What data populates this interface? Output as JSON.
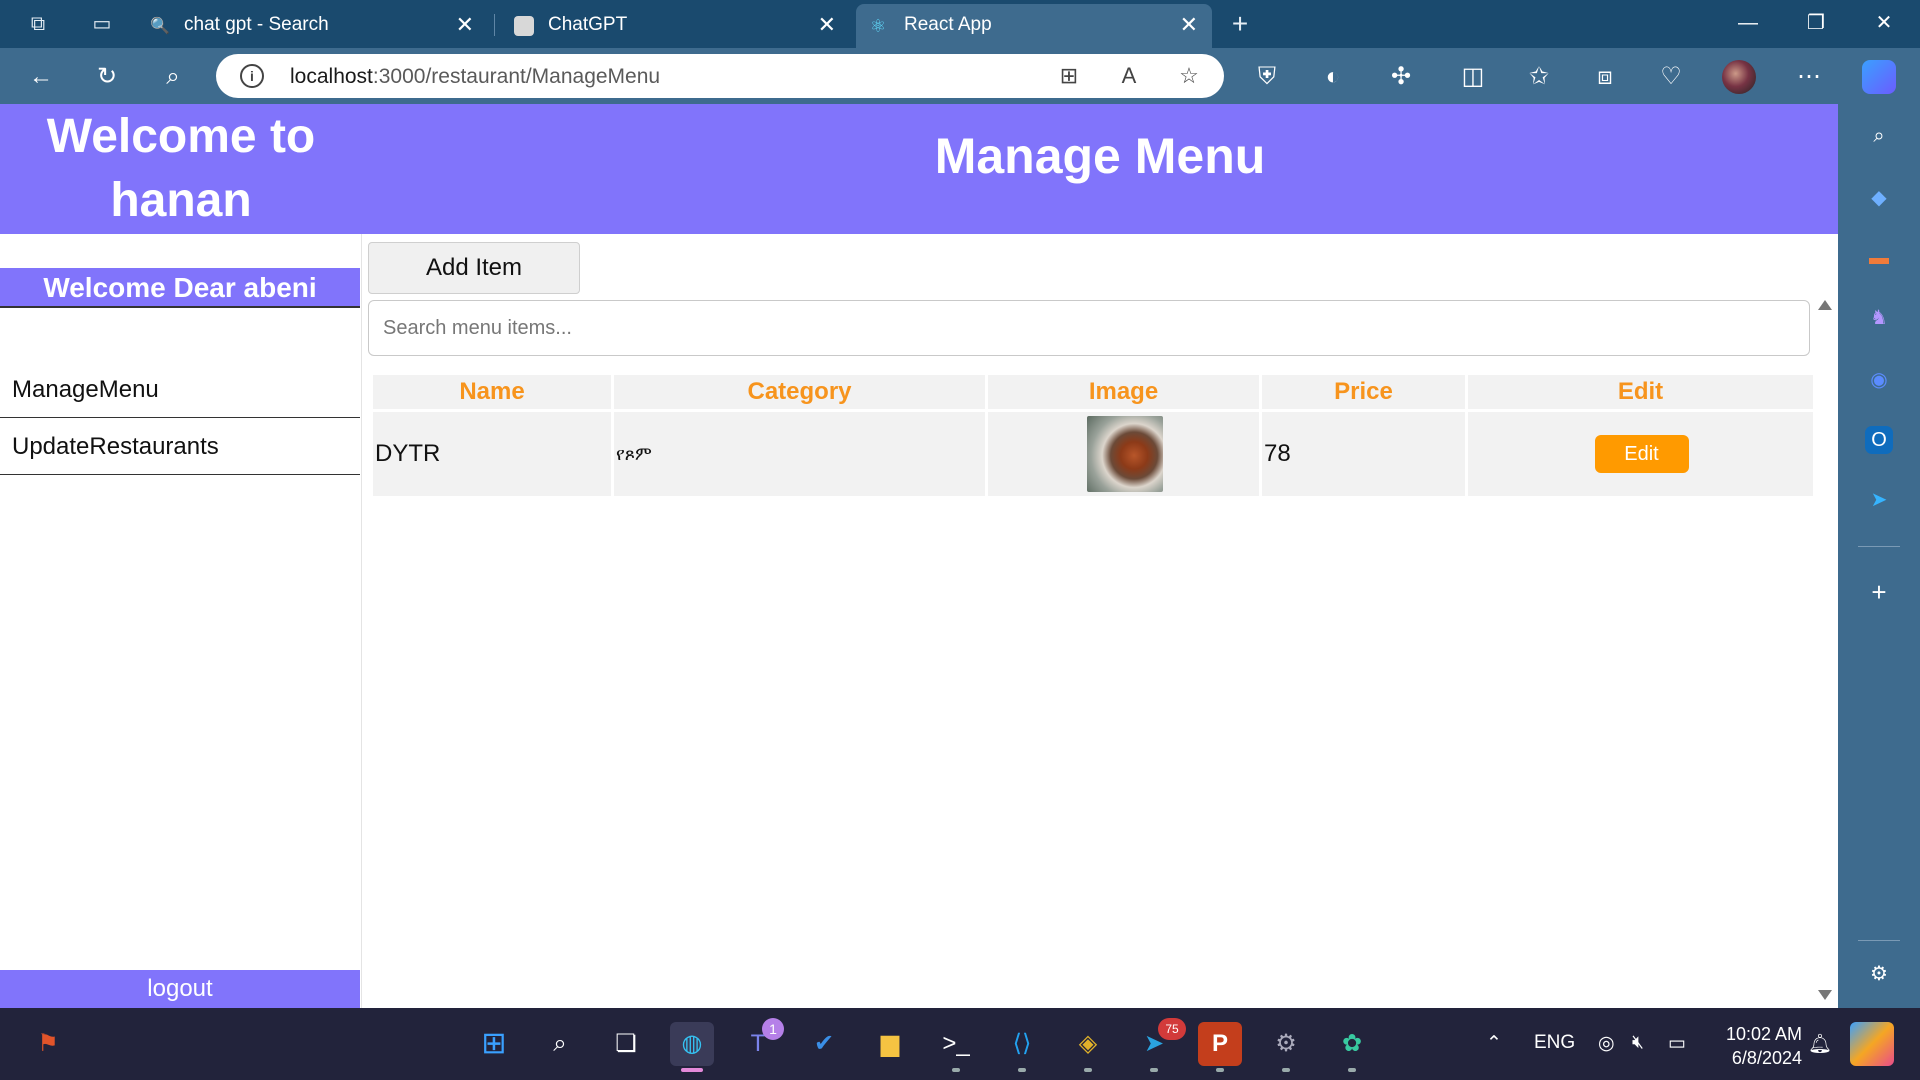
{
  "browser": {
    "tabs": [
      {
        "title": "chat gpt - Search",
        "active": false
      },
      {
        "title": "ChatGPT",
        "active": false
      },
      {
        "title": "React App",
        "active": true
      }
    ],
    "url_host": "localhost",
    "url_path": ":3000/restaurant/ManageMenu"
  },
  "sidebar": {
    "welcome_title": "Welcome to hanan",
    "greeting": "Welcome Dear abeni",
    "nav": [
      {
        "label": "ManageMenu"
      },
      {
        "label": "UpdateRestaurants"
      }
    ],
    "logout_label": "logout"
  },
  "main": {
    "title": "Manage Menu",
    "add_button": "Add Item",
    "search_placeholder": "Search menu items...",
    "search_value": "",
    "table": {
      "columns": [
        "Name",
        "Category",
        "Image",
        "Price",
        "Edit"
      ],
      "rows": [
        {
          "name": "DYTR",
          "category": "የጾም",
          "image": "food photo",
          "price": "78",
          "edit_label": "Edit"
        }
      ]
    }
  },
  "taskbar": {
    "teams_badge": "1",
    "telegram_badge": "75",
    "language": "ENG",
    "time": "10:02 AM",
    "date": "6/8/2024"
  },
  "colors": {
    "header_purple": "#8174fb",
    "accent_orange": "#f7941d",
    "edit_button": "#ff9a00",
    "browser_chrome": "#3e6b8e"
  }
}
